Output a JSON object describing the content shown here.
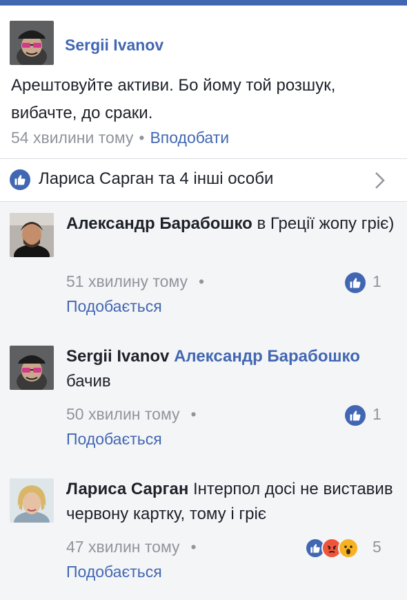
{
  "post": {
    "author": "Sergii Ivanov",
    "text": "Арештовуйте активи. Бо йому той розшук, вибачте, до сраки.",
    "time": "54 хвилини тому",
    "separator": "•",
    "like_label": "Вподобати"
  },
  "reactions": {
    "summary": "Лариса Сарган та 4 інші особи"
  },
  "comments": [
    {
      "author": "Александр Барабошко",
      "mention": "",
      "text": "в Греції жопу гріє)",
      "time": "51 хвилину тому",
      "separator": "•",
      "like_label": "Подобається",
      "likes": "1"
    },
    {
      "author": "Sergii Ivanov",
      "mention": "Александр Барабошко",
      "text": "бачив",
      "time": "50 хвилин тому",
      "separator": "•",
      "like_label": "Подобається",
      "likes": "1"
    },
    {
      "author": "Лариса Сарган",
      "mention": "",
      "text": "Інтерпол досі не виставив червону картку, тому і гріє",
      "time": "47 хвилин тому",
      "separator": "•",
      "like_label": "Подобається",
      "likes": "5"
    }
  ],
  "colors": {
    "brand": "#4267b2",
    "muted": "#90949c",
    "angry": "#f0553b",
    "wow": "#f7b125"
  }
}
